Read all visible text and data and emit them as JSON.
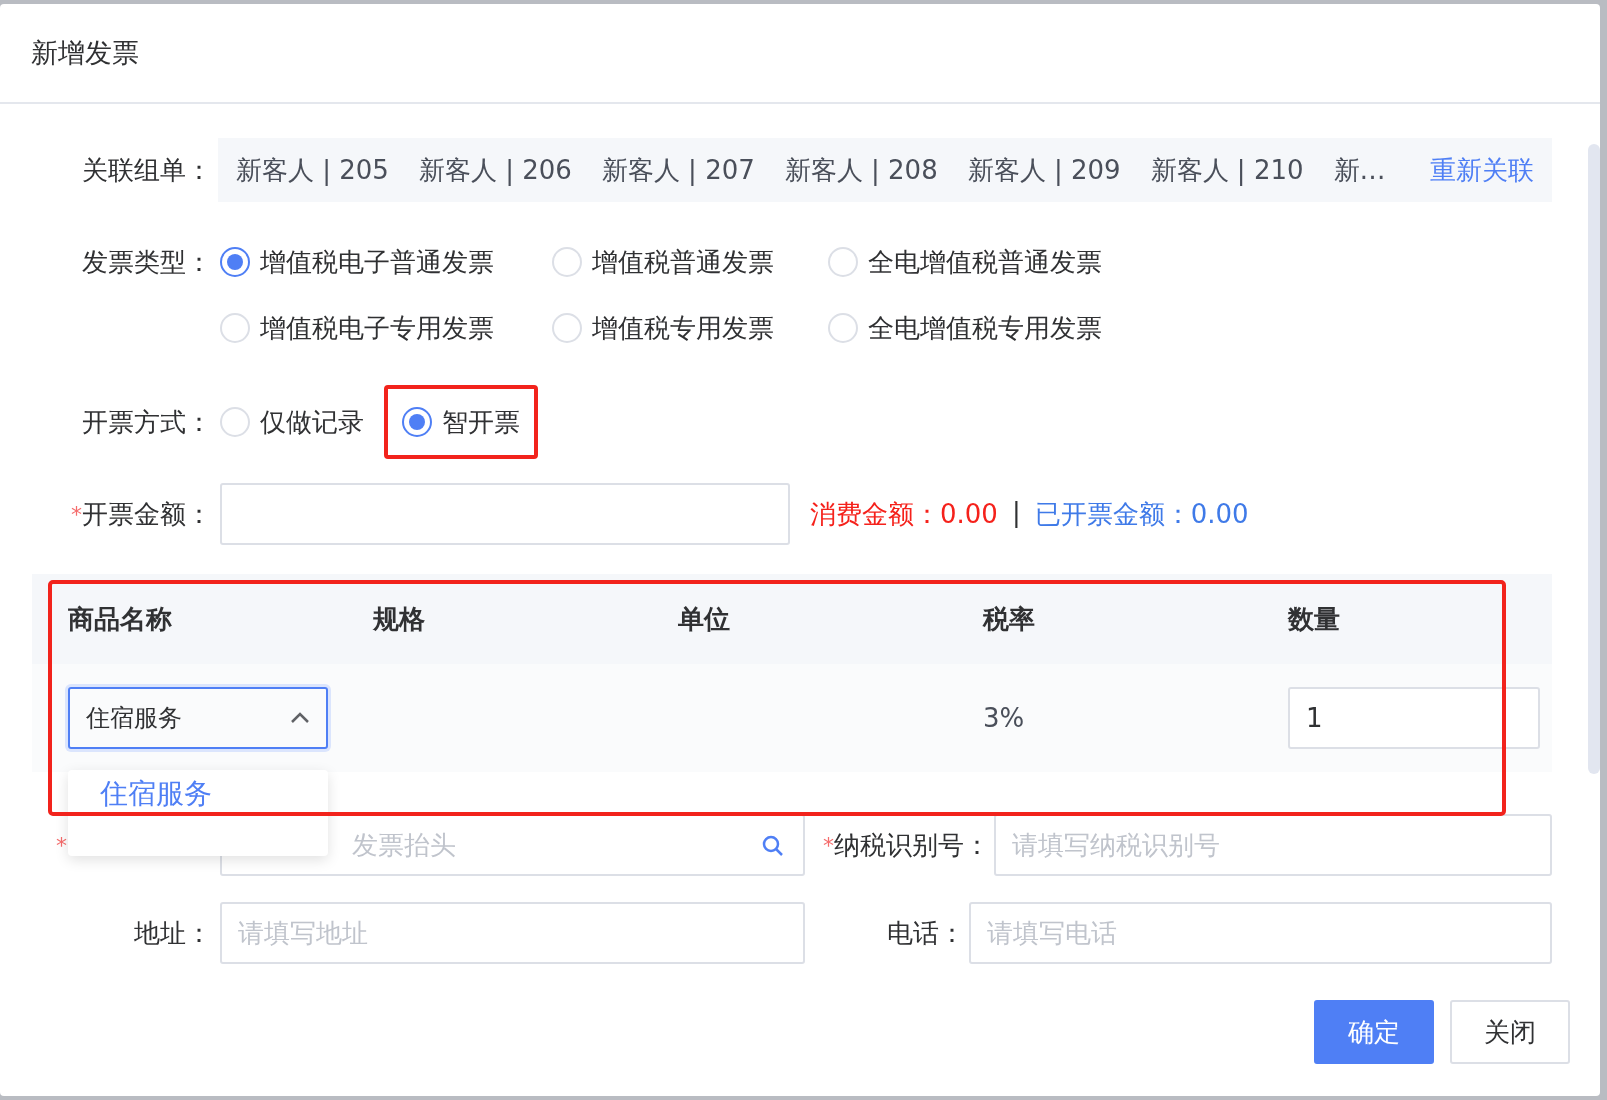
{
  "dialog": {
    "title": "新增发票"
  },
  "linked_orders": {
    "label": "关联组单：",
    "orders": [
      "新客人 | 205",
      "新客人 | 206",
      "新客人 | 207",
      "新客人 | 208",
      "新客人 | 209",
      "新客人 | 210",
      "新…"
    ],
    "relink": "重新关联"
  },
  "invoice_type": {
    "label": "发票类型：",
    "options": [
      {
        "label": "增值税电子普通发票",
        "selected": true
      },
      {
        "label": "增值税普通发票",
        "selected": false
      },
      {
        "label": "全电增值税普通发票",
        "selected": false
      },
      {
        "label": "增值税电子专用发票",
        "selected": false
      },
      {
        "label": "增值税专用发票",
        "selected": false
      },
      {
        "label": "全电增值税专用发票",
        "selected": false
      }
    ]
  },
  "issue_method": {
    "label": "开票方式：",
    "options": [
      {
        "label": "仅做记录",
        "selected": false,
        "highlighted": false
      },
      {
        "label": "智开票",
        "selected": true,
        "highlighted": true
      }
    ]
  },
  "amount": {
    "required_mark": "*",
    "label": "开票金额：",
    "consumed_label": "消费金额：",
    "consumed": "0.00",
    "separator": "|",
    "invoiced_label": "已开票金额：",
    "invoiced": "0.00"
  },
  "items_table": {
    "highlighted": true,
    "columns": [
      "商品名称",
      "规格",
      "单位",
      "税率",
      "数量"
    ],
    "rows": [
      {
        "product": "住宿服务",
        "expanded": true,
        "tax_rate": "3%",
        "quantity": "1"
      }
    ],
    "dropdown_options": [
      {
        "label": "住宿服务",
        "selected": true
      }
    ]
  },
  "title_row": {
    "required_mark": "*",
    "placeholder": "发票抬头",
    "tax_id_required_mark": "*",
    "tax_id_label": "纳税识别号：",
    "tax_id_placeholder": "请填写纳税识别号"
  },
  "address_row": {
    "address_label": "地址：",
    "address_placeholder": "请填写地址",
    "phone_label": "电话：",
    "phone_placeholder": "请填写电话"
  },
  "buttons": [
    {
      "label": "确定",
      "kind": "primary"
    },
    {
      "label": "关闭",
      "kind": "default"
    }
  ]
}
